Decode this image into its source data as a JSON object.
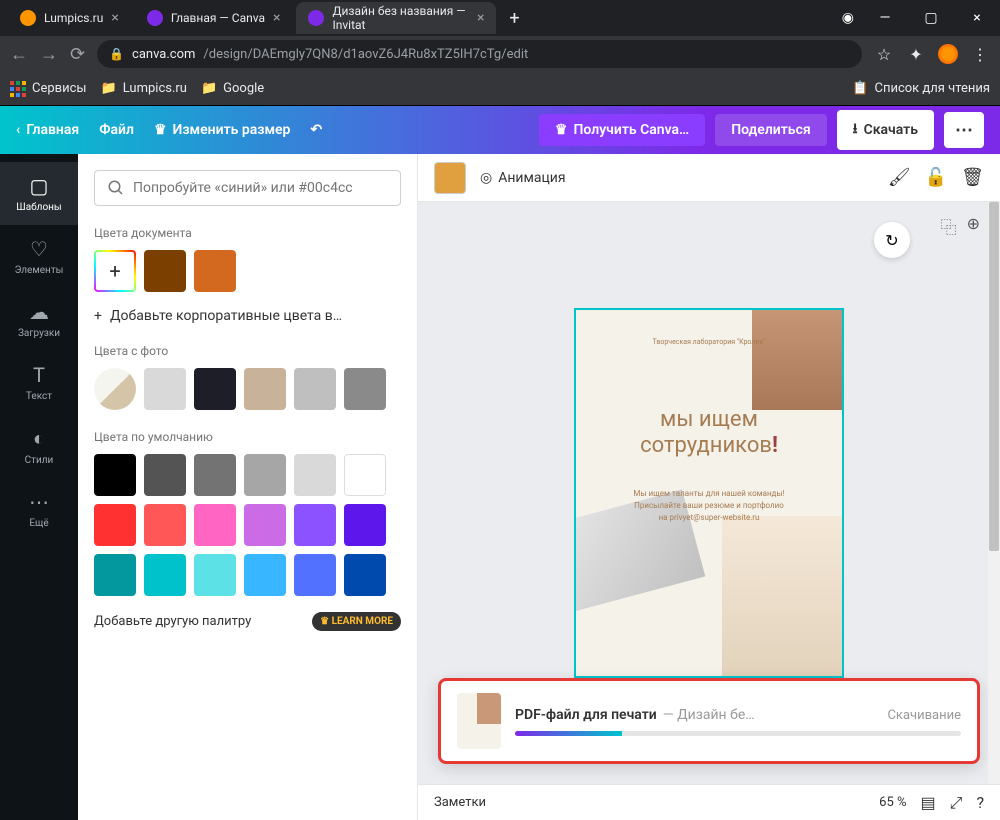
{
  "browser": {
    "tabs": [
      {
        "title": "Lumpics.ru",
        "active": false,
        "favicon_color": "#ff9500"
      },
      {
        "title": "Главная — Canva",
        "active": false,
        "favicon_color": "#00c4cc"
      },
      {
        "title": "Дизайн без названия — Invitat",
        "active": true,
        "favicon_color": "#00c4cc"
      }
    ],
    "url_domain": "canva.com",
    "url_path": "/design/DAEmgly7QN8/d1aovZ6J4Ru8xTZ5IH7cTg/edit",
    "bookmarks": {
      "services": "Сервисы",
      "items": [
        "Lumpics.ru",
        "Google"
      ],
      "reading_list": "Список для чтения"
    }
  },
  "toolbar": {
    "home": "Главная",
    "file": "Файл",
    "resize": "Изменить размер",
    "get_pro": "Получить Canva…",
    "share": "Поделиться",
    "download": "Скачать"
  },
  "sidebar": {
    "items": [
      {
        "label": "Шаблоны",
        "icon": "▢"
      },
      {
        "label": "Элементы",
        "icon": "♡"
      },
      {
        "label": "Загрузки",
        "icon": "☁"
      },
      {
        "label": "Текст",
        "icon": "T"
      },
      {
        "label": "Стили",
        "icon": "◐"
      },
      {
        "label": "Ещё",
        "icon": "⋯"
      }
    ],
    "active_index": 0
  },
  "panel": {
    "search_placeholder": "Попробуйте «синий» или #00c4cc",
    "doc_colors_title": "Цвета документа",
    "doc_colors": [
      "#7b3f00",
      "#d2691e"
    ],
    "add_corp": "Добавьте корпоративные цвета в…",
    "photo_title": "Цвета с фото",
    "photo_colors": [
      "#d9d9d9",
      "#1e1e28",
      "#c8b29a",
      "#bfbfbf",
      "#8a8a8a"
    ],
    "default_title": "Цвета по умолчанию",
    "default_colors": [
      "#000000",
      "#545454",
      "#737373",
      "#a6a6a6",
      "#d9d9d9",
      "#ffffff",
      "#ff3131",
      "#ff5757",
      "#ff66c4",
      "#cb6ce6",
      "#8c52ff",
      "#5e17eb",
      "#03989e",
      "#00c2cb",
      "#5ce1e6",
      "#38b6ff",
      "#5271ff",
      "#004aad"
    ],
    "learn_more_label": "Добавьте другую палитру",
    "learn_more_badge": "LEARN MORE"
  },
  "canvas_toolbar": {
    "animation": "Анимация"
  },
  "canvas": {
    "lab_name": "Творческая лаборатория \"Кролик\"",
    "title_line1": "мы ищем",
    "title_line2": "сотрудников",
    "body": "Мы ищем таланты для нашей команды! Присылайте ваши резюме и портфолио на privyet@super-website.ru"
  },
  "download_toast": {
    "title": "PDF-файл для печати",
    "subtitle": "— Дизайн бе…",
    "status": "Скачивание",
    "progress_pct": 24
  },
  "footer": {
    "notes": "Заметки",
    "zoom": "65 %"
  }
}
